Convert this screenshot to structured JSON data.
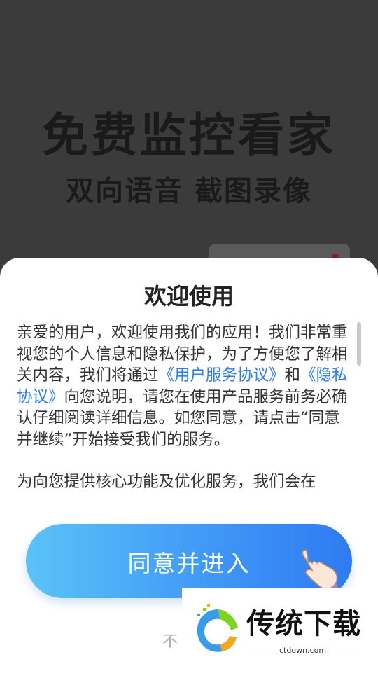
{
  "background": {
    "headline": "免费监控看家",
    "subheadline": "双向语音 截图录像"
  },
  "dialog": {
    "title": "欢迎使用",
    "para1_a": "亲爱的用户，欢迎使用我们的应用！我们非常重视您的个人信息和隐私保护，为了方便您了解相关内容，我们将通过",
    "link_user_agreement": "《用户服务协议》",
    "para1_and": "和",
    "link_privacy": "《隐私协议》",
    "para1_b": "向您说明，请您在使用产品服务前务必确认仔细阅读详细信息。如您同意，请点击“同意并继续”开始接受我们的服务。",
    "para2": "为向您提供核心功能及优化服务，我们会在",
    "agree_button": "同意并进入",
    "decline_button": "不",
    "link_color": "#2e7cf6",
    "button_gradient": [
      "#5ac3f7",
      "#2f7bf2"
    ]
  },
  "watermark": {
    "name": "传统下载",
    "url": "ctdown.com"
  }
}
